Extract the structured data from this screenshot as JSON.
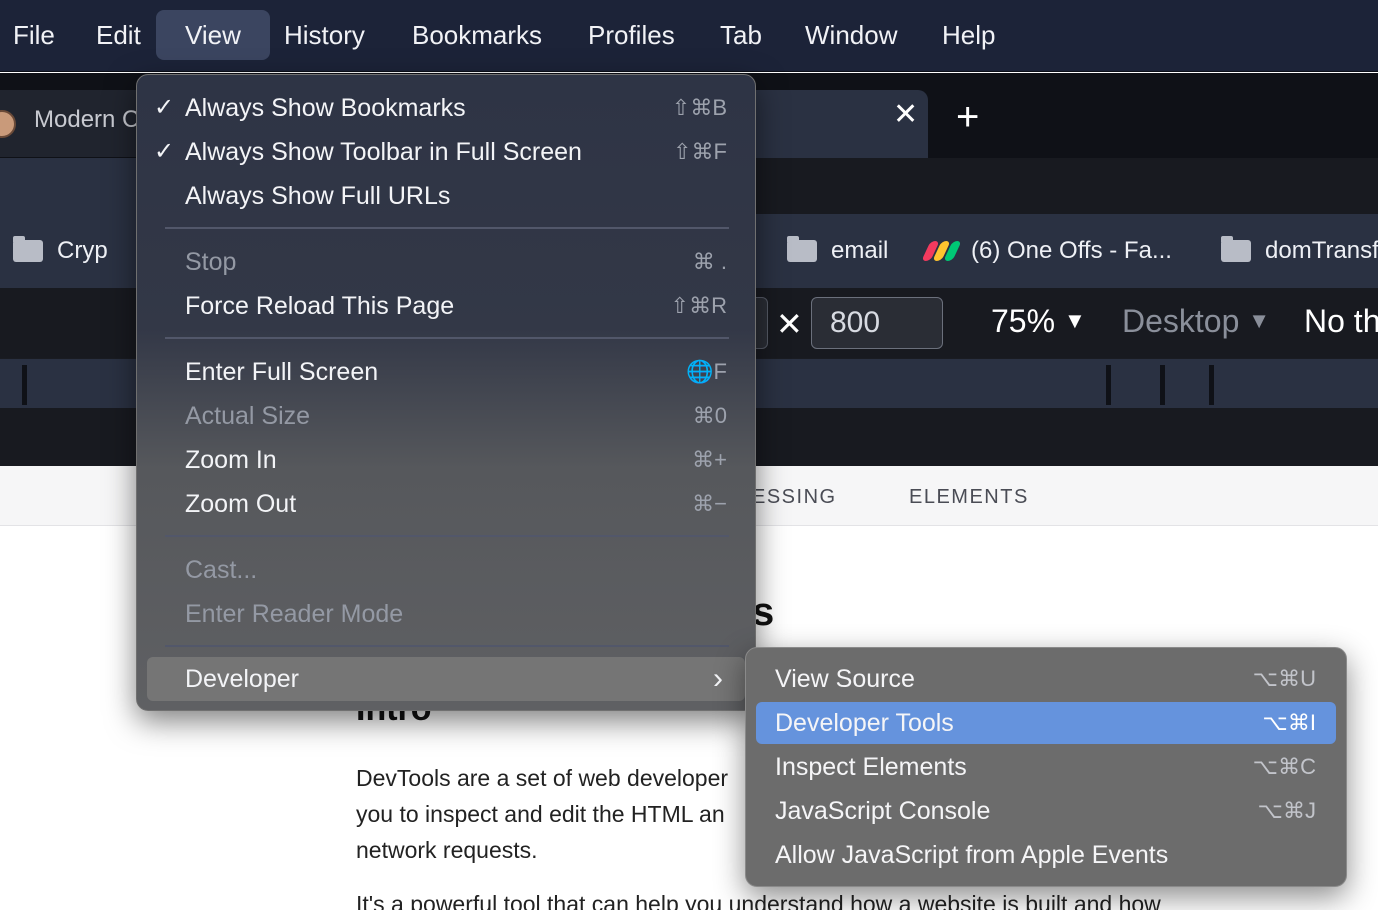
{
  "menubar": {
    "items": [
      "File",
      "Edit",
      "View",
      "History",
      "Bookmarks",
      "Profiles",
      "Tab",
      "Window",
      "Help"
    ]
  },
  "tabs": {
    "left_title": "Modern C",
    "close_glyph": "✕",
    "new_tab_glyph": "+"
  },
  "bookmarks": {
    "items": [
      "Cryp",
      "email",
      "(6) One Offs - Fa...",
      "domTransf"
    ]
  },
  "devtools_bar": {
    "times": "✕",
    "height_value": "800",
    "zoom": "75%",
    "device": "Desktop",
    "throttle": "No th",
    "caret": "▼"
  },
  "site": {
    "nav": [
      "ESSING",
      "ELEMENTS"
    ],
    "heading_fragment": "s",
    "intro_heading": "Intro",
    "para1_lines": [
      "DevTools are a set of web developer",
      "you to inspect and edit the HTML an",
      "network requests."
    ],
    "para2_line": "It's a powerful tool that can help you understand how a website is built and how"
  },
  "view_menu": {
    "items": [
      {
        "label": "Always Show Bookmarks",
        "checked": "✓",
        "shortcut": "⇧⌘B"
      },
      {
        "label": "Always Show Toolbar in Full Screen",
        "checked": "✓",
        "shortcut": "⇧⌘F"
      },
      {
        "label": "Always Show Full URLs",
        "shortcut": ""
      },
      {
        "label": "Stop",
        "shortcut": "⌘ .",
        "disabled": true
      },
      {
        "label": "Force Reload This Page",
        "shortcut": "⇧⌘R"
      },
      {
        "label": "Enter Full Screen",
        "shortcut": "🌐F"
      },
      {
        "label": "Actual Size",
        "shortcut": "⌘0",
        "disabled": true
      },
      {
        "label": "Zoom In",
        "shortcut": "⌘+"
      },
      {
        "label": "Zoom Out",
        "shortcut": "⌘−"
      },
      {
        "label": "Cast...",
        "shortcut": "",
        "disabled": true
      },
      {
        "label": "Enter Reader Mode",
        "shortcut": "",
        "disabled": true
      },
      {
        "label": "Developer",
        "submenu_arrow": "›"
      }
    ]
  },
  "developer_menu": {
    "items": [
      {
        "label": "View Source",
        "shortcut": "⌥⌘U"
      },
      {
        "label": "Developer Tools",
        "shortcut": "⌥⌘I",
        "selected": true
      },
      {
        "label": "Inspect Elements",
        "shortcut": "⌥⌘C"
      },
      {
        "label": "JavaScript Console",
        "shortcut": "⌥⌘J"
      },
      {
        "label": "Allow JavaScript from Apple Events",
        "shortcut": ""
      }
    ]
  },
  "colors": {
    "menubar_bg": "#1c2338",
    "selection_blue": "#6593dd",
    "menu_highlight": "#757575"
  }
}
